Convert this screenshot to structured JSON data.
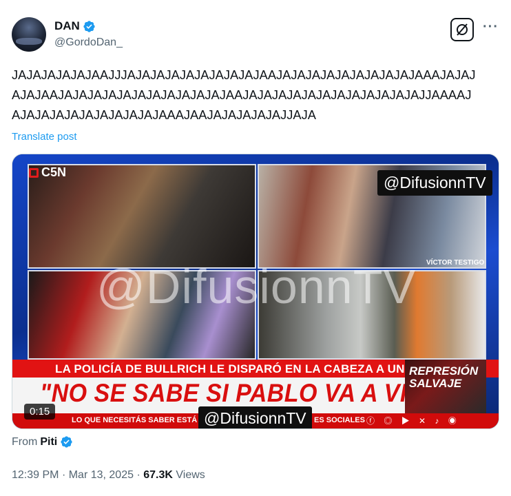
{
  "author": {
    "display_name": "DAN",
    "handle": "@GordoDan_",
    "verified_icon": "verified-badge-icon"
  },
  "actions": {
    "grok_icon": "grok-icon",
    "more_label": "···"
  },
  "tweet": {
    "lines": [
      "JAJAJAJAJAJAAJJJAJAJAJAJAJAJAJAJAJAAJAJAJAJAJAJAJAJAJAJAAAJAJAJ",
      "AJAJAAJAJAJAJAJAJAJAJAJAJAJAJAAJAJAJAJAJAJAJAJAJAJAJAJAJJAAAAJ",
      "AJAJAJAJAJAJAJAJAJAJAAAJAAJAJAJAJAJAJJAJA"
    ],
    "translate_label": "Translate post"
  },
  "media": {
    "channel_logo": "C5N",
    "watermark": "@DifusionnTV",
    "witness_label": "VÍCTOR TESTIGO",
    "subheadline": "LA POLICÍA DE BULLRICH LE DISPARÓ EN LA CABEZA A UN FOTÓGRAFO",
    "headline": "\"NO SE SABE SI PABLO VA A VIVIR\"",
    "segment_title": "REPRESIÓN SALVAJE",
    "ticker_left": "LO QUE NECESITÁS SABER ESTÁ EN W",
    "ticker_right": "ES SOCIALES",
    "social_icons": "ⓕ ◎ ▶ ✕ ♪ ◉",
    "duration": "0:15"
  },
  "source": {
    "prefix": "From",
    "name": "Piti"
  },
  "meta": {
    "time": "12:39 PM",
    "separator": "·",
    "date": "Mar 13, 2025",
    "views_count": "67.3K",
    "views_label": "Views"
  },
  "colors": {
    "accent": "#1d9bf0",
    "text": "#0f1419",
    "secondary": "#536471",
    "news_red": "#e11313"
  }
}
